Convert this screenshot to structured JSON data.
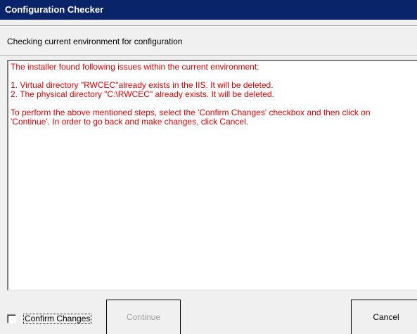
{
  "window": {
    "title": "Configuration Checker"
  },
  "status": {
    "text": "Checking current environment for configuration"
  },
  "message": {
    "intro": "The installer found following issues within the current environment:",
    "issues": [
      "1. Virtual directory \"RWCEC\"already exists in the IIS. It will be deleted.",
      "2. The physical directory \"C:\\RWCEC\" already exists. It will be deleted."
    ],
    "instructions_line1": "To perform the above mentioned steps, select the 'Confirm Changes' checkbox and then click on",
    "instructions_line2": "'Continue'. In order to go back and make changes, click Cancel.",
    "text_color": "#e00000"
  },
  "confirm": {
    "label": "Confirm Changes",
    "checked": false
  },
  "buttons": {
    "continue_label": "Continue",
    "continue_enabled": false,
    "cancel_label": "Cancel"
  },
  "colors": {
    "title_bar": "#0a246a",
    "window_bg": "#f0f0f0"
  }
}
